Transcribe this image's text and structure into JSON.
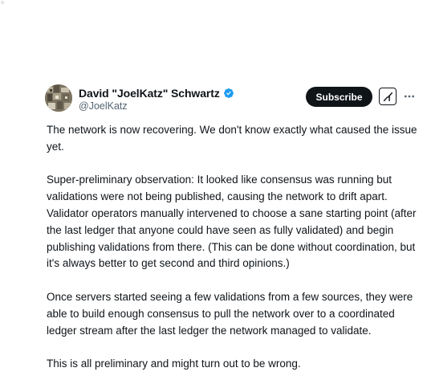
{
  "corner_text": "a",
  "author": {
    "display_name": "David \"JoelKatz\" Schwartz",
    "handle": "@JoelKatz",
    "verified_icon": "verified-badge-icon",
    "verified_color": "#1d9bf0"
  },
  "actions": {
    "subscribe_label": "Subscribe",
    "grok_icon": "grok-icon",
    "more_icon": "more-options-icon"
  },
  "tweet": {
    "paragraphs": [
      "The network is now recovering. We don't know exactly what caused the issue yet.",
      "Super-preliminary observation: It looked like consensus was running but validations were not being published, causing the network to drift apart. Validator operators manually intervened to choose a sane starting point (after the last ledger that anyone could have seen as fully validated) and begin publishing validations from there. (This can be done without coordination, but it's always better to get second and third opinions.)",
      "Once servers started seeing a few validations from a few sources, they were able to build enough consensus to pull the network over to a coordinated ledger stream after the last ledger the network managed to validate.",
      "This is all preliminary and might turn out to be wrong."
    ]
  },
  "colors": {
    "text_primary": "#0f1419",
    "text_secondary": "#536471",
    "button_bg": "#0f1419"
  }
}
